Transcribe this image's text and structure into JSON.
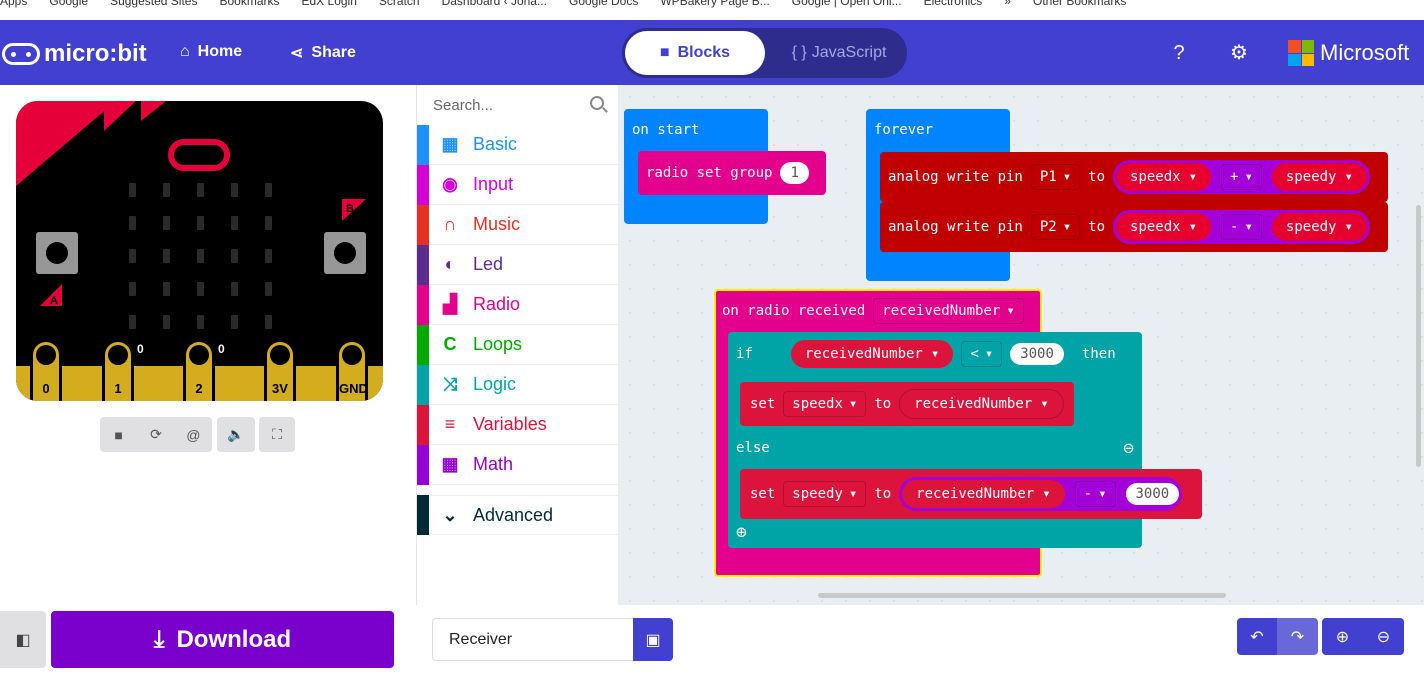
{
  "bookmarks": [
    "Apps",
    "Google",
    "Suggested Sites",
    "Bookmarks",
    "EdX Login",
    "Scratch",
    "Dashboard ‹ Jona...",
    "Google Docs",
    "WPBakery Page B...",
    "Google | Open Onl...",
    "Electronics",
    "»",
    "Other Bookmarks"
  ],
  "header": {
    "brand": "micro:bit",
    "home": "Home",
    "share": "Share",
    "blocks": "Blocks",
    "javascript": "JavaScript",
    "js_braces": "{ }",
    "microsoft": "Microsoft",
    "colors": {
      "bar": "#4140d1"
    }
  },
  "simulator": {
    "pins": [
      "0",
      "1",
      "2",
      "3V",
      "GND"
    ],
    "pin_values": [
      "0",
      "0"
    ],
    "button_a": "A",
    "button_b": "B"
  },
  "toolbox": {
    "search_placeholder": "Search...",
    "categories": [
      {
        "label": "Basic",
        "color": "#1e90ff",
        "icon": "grid-icon"
      },
      {
        "label": "Input",
        "color": "#d400d4",
        "icon": "target-icon"
      },
      {
        "label": "Music",
        "color": "#e63022",
        "icon": "headphones-icon"
      },
      {
        "label": "Led",
        "color": "#5c2d91",
        "icon": "toggle-icon"
      },
      {
        "label": "Radio",
        "color": "#e3008c",
        "icon": "signal-icon"
      },
      {
        "label": "Loops",
        "color": "#00aa00",
        "icon": "refresh-icon"
      },
      {
        "label": "Logic",
        "color": "#00a4a6",
        "icon": "shuffle-icon"
      },
      {
        "label": "Variables",
        "color": "#dc143c",
        "icon": "list-icon"
      },
      {
        "label": "Math",
        "color": "#9400d3",
        "icon": "calculator-icon"
      }
    ],
    "advanced": "Advanced"
  },
  "workspace": {
    "on_start": {
      "label": "on start",
      "radio_set_group": "radio set group",
      "group": "1"
    },
    "forever": {
      "label": "forever",
      "rows": [
        {
          "cmd": "analog write pin",
          "pin": "P1",
          "to": "to",
          "a": "speedx",
          "op": "+",
          "b": "speedy"
        },
        {
          "cmd": "analog write pin",
          "pin": "P2",
          "to": "to",
          "a": "speedx",
          "op": "-",
          "b": "speedy"
        }
      ]
    },
    "on_radio": {
      "label": "on radio received",
      "param": "receivedNumber",
      "if": "if",
      "cond_var": "receivedNumber",
      "cond_op": "<",
      "cond_val": "3000",
      "then": "then",
      "set1": {
        "set": "set",
        "var": "speedx",
        "to": "to",
        "val": "receivedNumber"
      },
      "else": "else",
      "set2": {
        "set": "set",
        "var": "speedy",
        "to": "to",
        "a": "receivedNumber",
        "op": "-",
        "b": "3000"
      }
    }
  },
  "footer": {
    "download": "Download",
    "project_name": "Receiver"
  }
}
